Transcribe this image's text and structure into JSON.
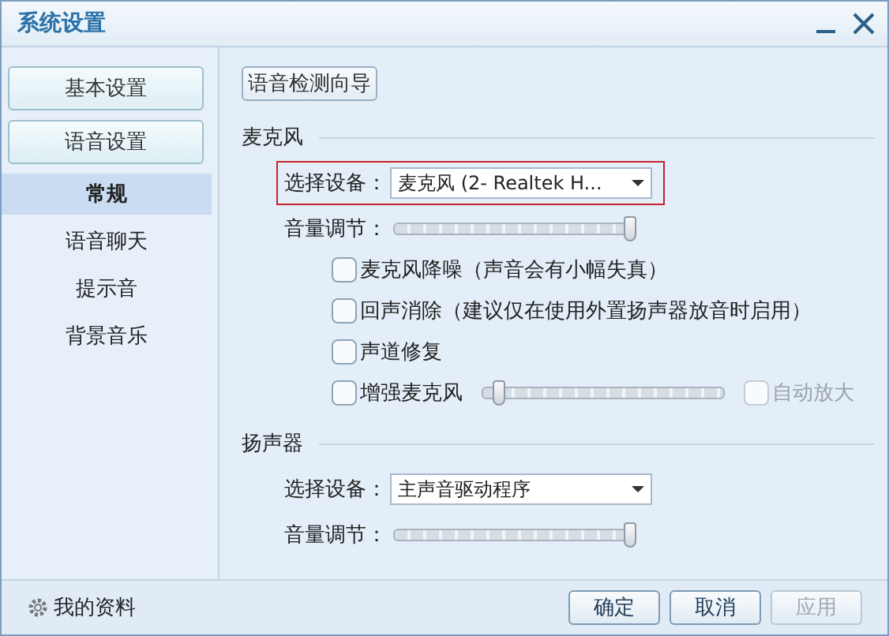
{
  "window": {
    "title": "系统设置"
  },
  "sidebar": {
    "groups": [
      {
        "label": "基本设置"
      },
      {
        "label": "语音设置",
        "children": [
          {
            "label": "常规",
            "selected": true
          },
          {
            "label": "语音聊天",
            "selected": false
          },
          {
            "label": "提示音",
            "selected": false
          },
          {
            "label": "背景音乐",
            "selected": false
          }
        ]
      }
    ]
  },
  "content": {
    "wizard_button": "语音检测向导",
    "sections": [
      {
        "title": "麦克风",
        "device": {
          "label": "选择设备：",
          "value": "麦克风 (2- Realtek H...",
          "highlighted": true
        },
        "volume": {
          "label": "音量调节：",
          "level": 1
        },
        "options": [
          {
            "kind": "checkbox",
            "label": "麦克风降噪（声音会有小幅失真）",
            "checked": false
          },
          {
            "kind": "checkbox",
            "label": "回声消除（建议仅在使用外置扬声器放音时启用）",
            "checked": false
          },
          {
            "kind": "checkbox",
            "label": "声道修复",
            "checked": false
          },
          {
            "kind": "boost",
            "label": "增强麦克风",
            "checked": false,
            "level": 0.05,
            "auto": {
              "label": "自动放大",
              "checked": false,
              "disabled": true
            }
          }
        ]
      },
      {
        "title": "扬声器",
        "device": {
          "label": "选择设备：",
          "value": "主声音驱动程序"
        },
        "volume": {
          "label": "音量调节：",
          "level": 1
        }
      }
    ]
  },
  "footer": {
    "profile_link": "我的资料",
    "buttons": [
      {
        "label": "确定",
        "disabled": false
      },
      {
        "label": "取消",
        "disabled": false
      },
      {
        "label": "应用",
        "disabled": true
      }
    ]
  }
}
